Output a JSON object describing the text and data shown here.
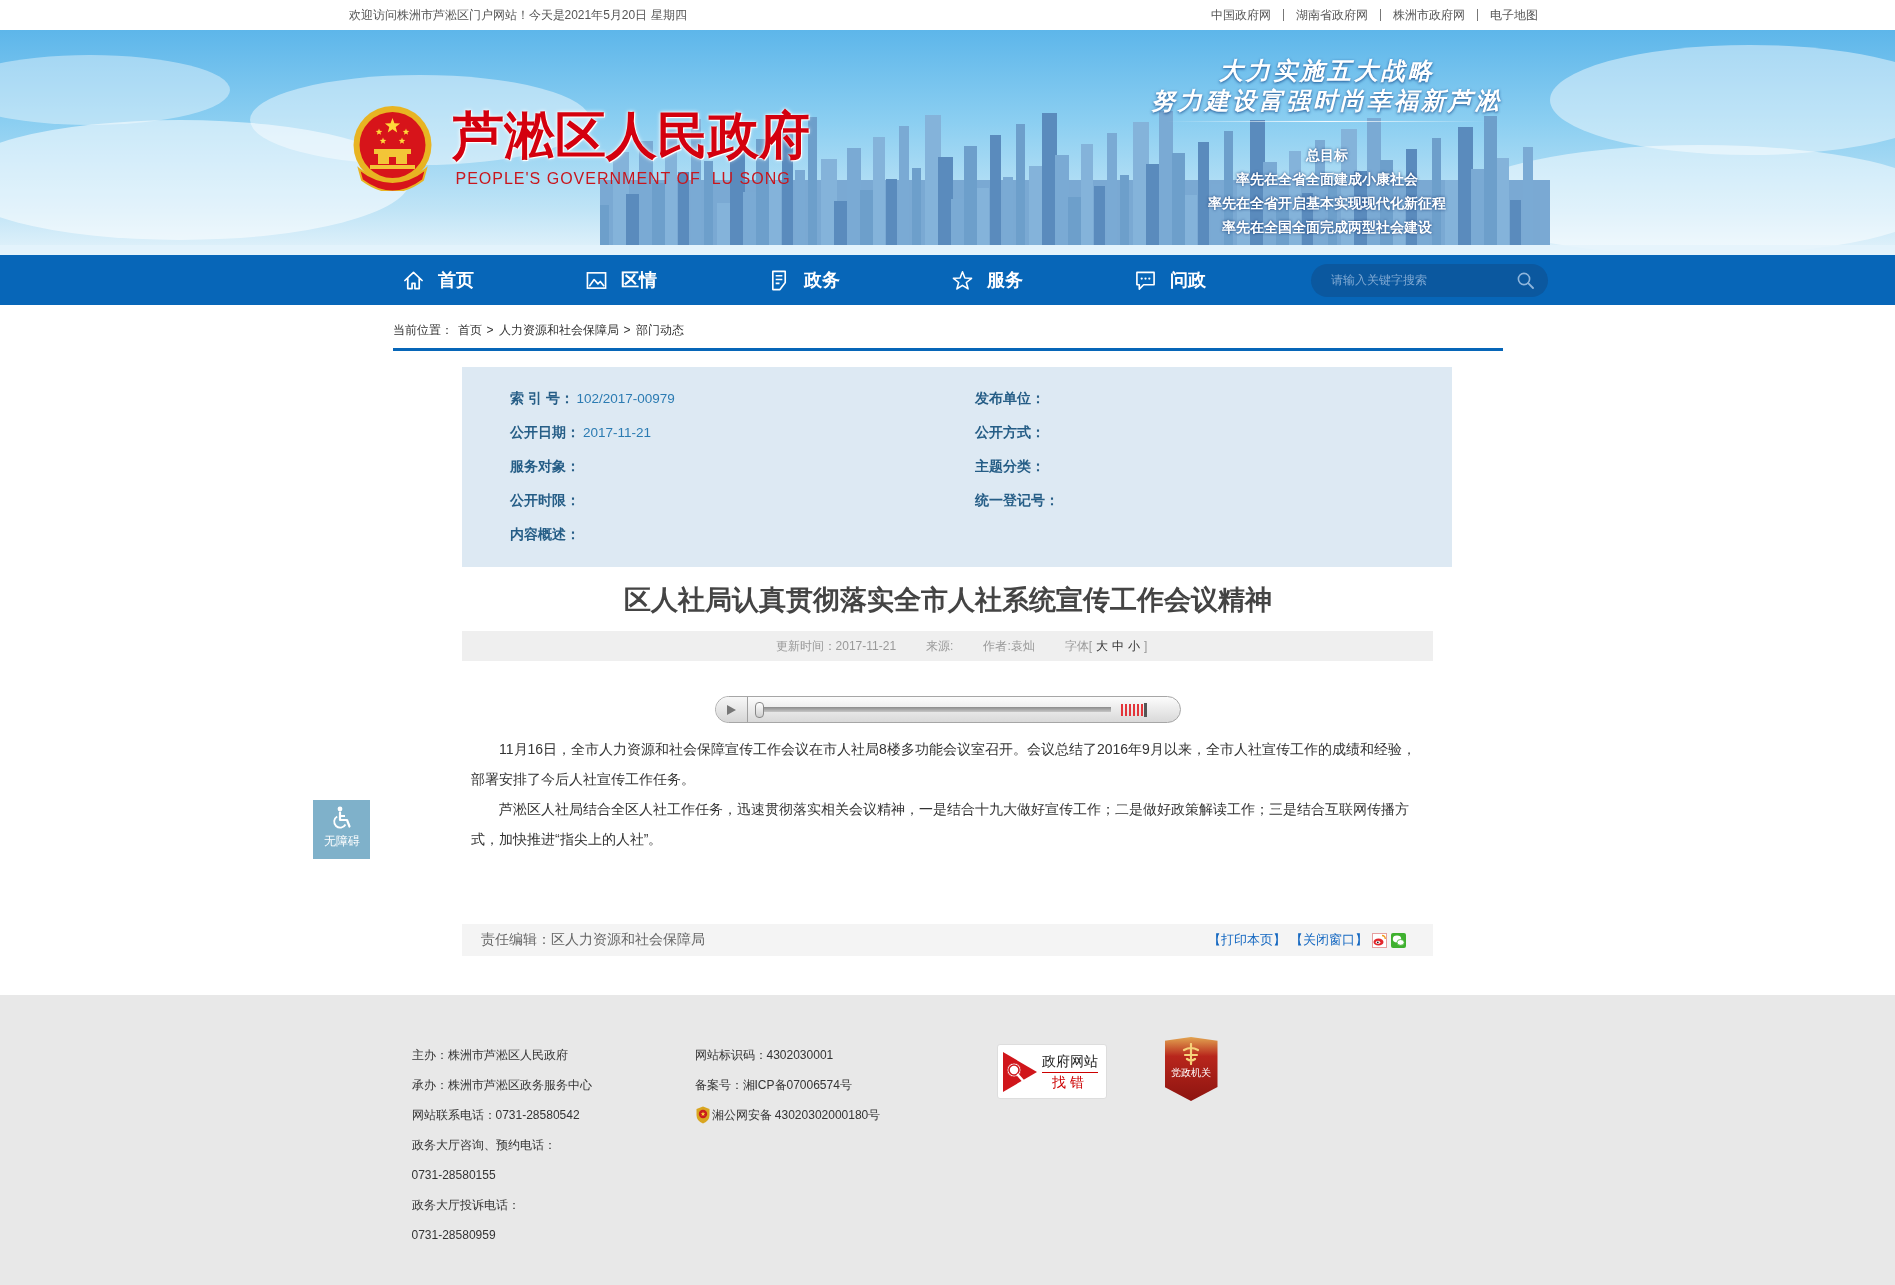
{
  "top_bar": {
    "welcome": "欢迎访问株洲市芦淞区门户网站！今天是2021年5月20日 星期四",
    "links": [
      "中国政府网",
      "湖南省政府网",
      "株洲市政府网",
      "电子地图"
    ]
  },
  "header": {
    "site_title": "芦淞区人民政府",
    "site_subtitle": "PEOPLE'S GOVERNMENT OF  LU SONG",
    "slogans": [
      "大力实施五大战略",
      "努力建设富强时尚幸福新芦淞"
    ],
    "goal_heading": "总目标",
    "goals": [
      "率先在全省全面建成小康社会",
      "率先在全省开启基本实现现代化新征程",
      "率先在全国全面完成两型社会建设"
    ]
  },
  "nav": {
    "items": [
      {
        "label": "首页"
      },
      {
        "label": "区情"
      },
      {
        "label": "政务"
      },
      {
        "label": "服务"
      },
      {
        "label": "问政"
      }
    ],
    "search": {
      "placeholder": "请输入关键字搜索"
    }
  },
  "breadcrumb": {
    "label": "当前位置：",
    "items": [
      {
        "text": "首页"
      },
      {
        "separator": ">",
        "text": "人力资源和社会保障局"
      },
      {
        "separator": ">",
        "text": "部门动态"
      }
    ]
  },
  "info_panel": {
    "fields": [
      {
        "label": "索 引 号：",
        "value": "102/2017-00979"
      },
      {
        "label": "发布单位："
      },
      {
        "label": "公开日期：",
        "value": "2017-11-21"
      },
      {
        "label": "公开方式："
      },
      {
        "label": "服务对象："
      },
      {
        "label": "主题分类："
      },
      {
        "label": "公开时限："
      },
      {
        "label": "统一登记号："
      },
      {
        "label": "内容概述："
      }
    ]
  },
  "article": {
    "title": "区人社局认真贯彻落实全市人社系统宣传工作会议精神",
    "meta": {
      "updated": "更新时间：2017-11-21",
      "source": "来源:",
      "author": "作者:袁灿",
      "font_size": {
        "open": "字体[",
        "options": [
          "大",
          "中",
          "小"
        ],
        "close": "]"
      }
    },
    "audio_player": {
      "progress": {
        "level": 0
      },
      "volume": {
        "level": 1
      }
    },
    "paragraphs": [
      "11月16日，全市人力资源和社会保障宣传工作会议在市人社局8楼多功能会议室召开。会议总结了2016年9月以来，全市人社宣传工作的成绩和经验，部署安排了今后人社宣传工作任务。",
      "芦淞区人社局结合全区人社工作任务，迅速贯彻落实相关会议精神，一是结合十九大做好宣传工作；二是做好政策解读工作；三是结合互联网传播方式，加快推进“指尖上的人社”。"
    ],
    "editor": "责任编辑：区人力资源和社会保障局",
    "actions": [
      "【打印本页】",
      "【关闭窗口】"
    ]
  },
  "accessibility_button": {
    "label": "无障碍"
  },
  "footer": {
    "left": [
      "主办：株洲市芦淞区人民政府",
      "承办：株洲市芦淞区政务服务中心",
      "网站联系电话：0731-28580542",
      "政务大厅咨询、预约电话：",
      "0731-28580155",
      "政务大厅投诉电话：",
      "0731-28580959"
    ],
    "middle": [
      {
        "kind": "text",
        "text": "网站标识码：4302030001"
      },
      {
        "kind": "text",
        "text": "备案号：湘ICP备07006574号"
      },
      {
        "kind": "police",
        "text": "湘公网安备 43020302000180号"
      }
    ],
    "error_badge": {
      "title": "政府网站",
      "subtitle": "找错"
    },
    "party_badge": {
      "label": "党政机关"
    }
  }
}
